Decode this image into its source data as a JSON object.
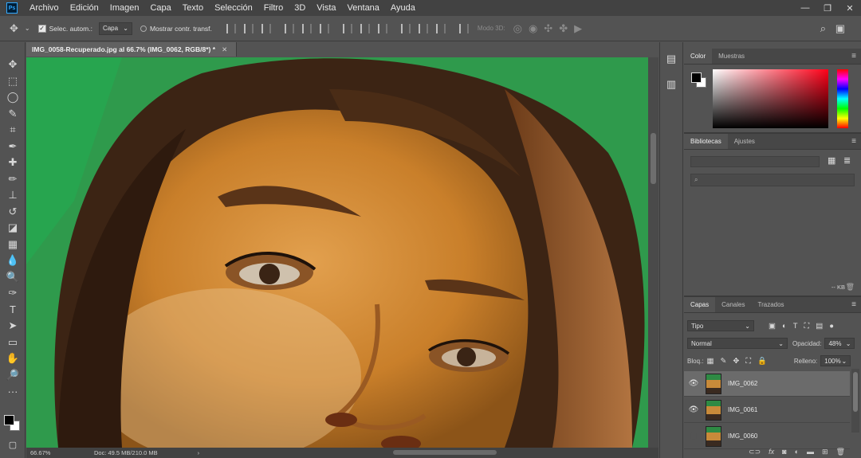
{
  "app": {
    "logo_text": "Ps"
  },
  "menu": [
    "Archivo",
    "Edición",
    "Imagen",
    "Capa",
    "Texto",
    "Selección",
    "Filtro",
    "3D",
    "Vista",
    "Ventana",
    "Ayuda"
  ],
  "window_controls": [
    "—",
    "❐",
    "✕"
  ],
  "options": {
    "auto_select_label": "Selec. autom.:",
    "auto_select_value": "Capa",
    "show_transform_label": "Mostrar contr. transf.",
    "mode3d_label": "Modo 3D:"
  },
  "tools": [
    "move-tool-icon",
    "marquee-tool-icon",
    "lasso-tool-icon",
    "quick-select-tool-icon",
    "crop-tool-icon",
    "eyedropper-tool-icon",
    "healing-brush-tool-icon",
    "brush-tool-icon",
    "clone-stamp-tool-icon",
    "history-brush-tool-icon",
    "eraser-tool-icon",
    "gradient-tool-icon",
    "blur-tool-icon",
    "dodge-tool-icon",
    "pen-tool-icon",
    "type-tool-icon",
    "path-select-tool-icon",
    "rectangle-tool-icon",
    "hand-tool-icon",
    "zoom-tool-icon",
    "more-tools-icon"
  ],
  "tool_glyphs": [
    "✥",
    "⬚",
    "◯",
    "✎",
    "⌗",
    "✒",
    "✚",
    "✏",
    "⊥",
    "↺",
    "◪",
    "▦",
    "💧",
    "🔍",
    "✑",
    "T",
    "➤",
    "▭",
    "✋",
    "🔎",
    "···"
  ],
  "document": {
    "tab_title": "IMG_0058-Recuperado.jpg al 66.7% (IMG_0062, RGB/8*) *",
    "zoom": "66.67%",
    "doc_size": "Doc: 49.5 MB/210.0 MB"
  },
  "color_panel": {
    "tabs": [
      "Color",
      "Muestras"
    ]
  },
  "libraries_panel": {
    "tabs": [
      "Bibliotecas",
      "Ajustes"
    ],
    "size": "-- KB"
  },
  "layers_panel": {
    "tabs": [
      "Capas",
      "Canales",
      "Trazados"
    ],
    "filter": "Tipo",
    "blend_mode": "Normal",
    "opacity_label": "Opacidad:",
    "opacity_value": "48%",
    "lock_label": "Bloq.:",
    "fill_label": "Relleno:",
    "fill_value": "100%",
    "layers": [
      {
        "name": "IMG_0062",
        "visible": true,
        "selected": true
      },
      {
        "name": "IMG_0061",
        "visible": true,
        "selected": false
      },
      {
        "name": "IMG_0060",
        "visible": false,
        "selected": false
      }
    ]
  }
}
